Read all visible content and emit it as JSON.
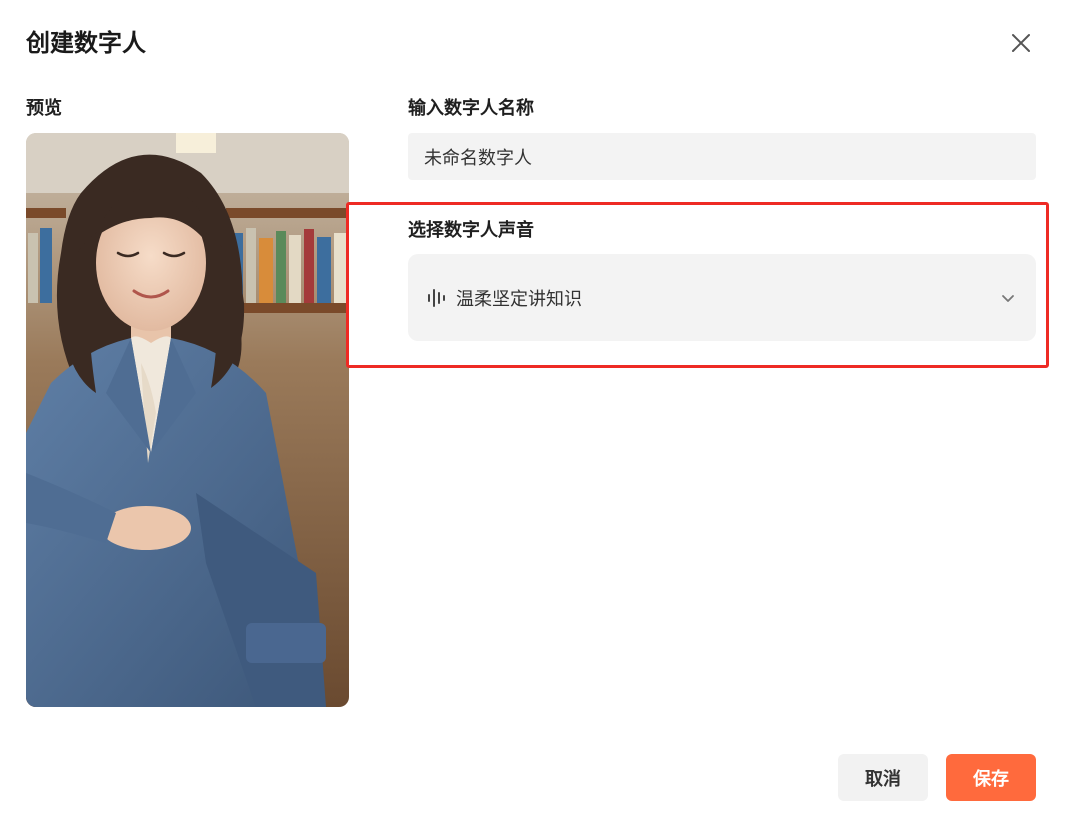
{
  "dialog": {
    "title": "创建数字人",
    "close_icon": "close-icon"
  },
  "preview": {
    "label": "预览",
    "image": "woman-in-blue-blazer-portrait"
  },
  "name_field": {
    "label": "输入数字人名称",
    "value": "未命名数字人"
  },
  "voice_field": {
    "label": "选择数字人声音",
    "icon": "soundwave-icon",
    "selected": "温柔坚定讲知识",
    "chevron": "chevron-down-icon",
    "highlight_color": "#ee2a24"
  },
  "actions": {
    "cancel_label": "取消",
    "save_label": "保存",
    "save_color": "#ff6a3d"
  }
}
